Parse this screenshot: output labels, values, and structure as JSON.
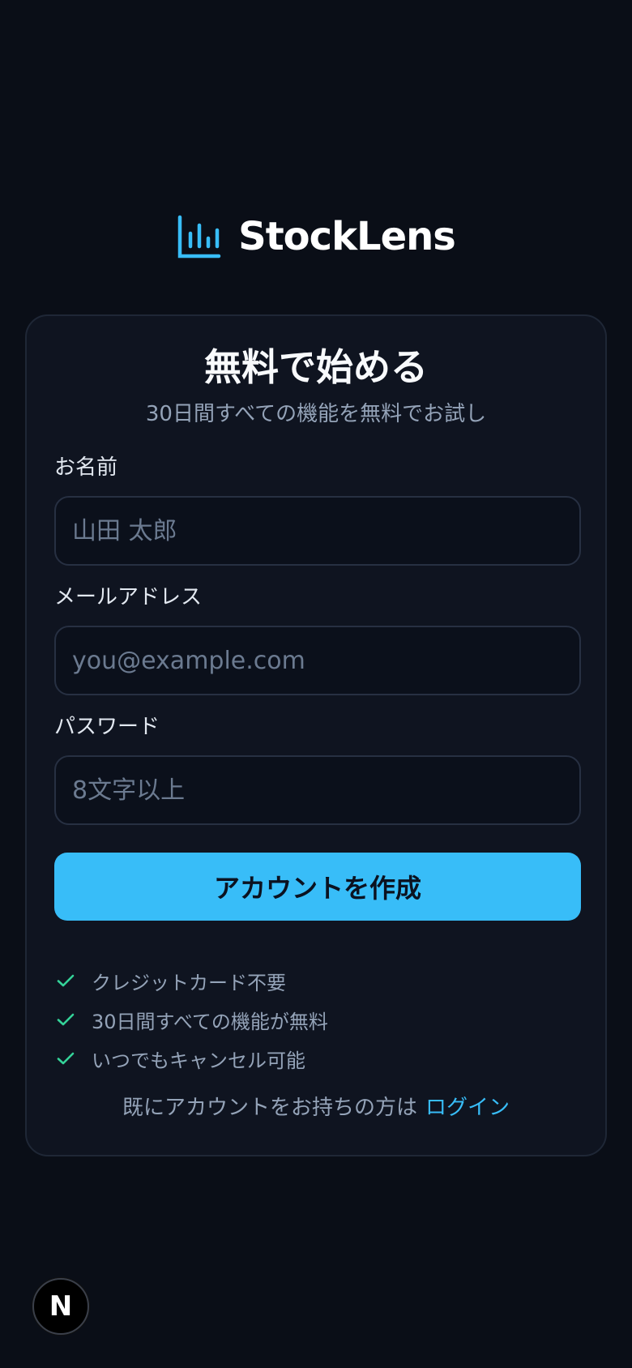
{
  "brand": {
    "name": "StockLens",
    "icon": "bar-chart-icon",
    "accent_color": "#38bdf8"
  },
  "signup": {
    "title": "無料で始める",
    "subtitle": "30日間すべての機能を無料でお試し",
    "fields": {
      "name": {
        "label": "お名前",
        "placeholder": "山田 太郎"
      },
      "email": {
        "label": "メールアドレス",
        "placeholder": "you@example.com"
      },
      "password": {
        "label": "パスワード",
        "placeholder": "8文字以上"
      }
    },
    "submit_label": "アカウントを作成",
    "features": [
      "クレジットカード不要",
      "30日間すべての機能が無料",
      "いつでもキャンセル可能"
    ],
    "check_color": "#34d399",
    "login_prompt": "既にアカウントをお持ちの方は",
    "login_link": "ログイン"
  },
  "dev_badge": {
    "letter": "N",
    "icon": "nextjs-icon"
  }
}
